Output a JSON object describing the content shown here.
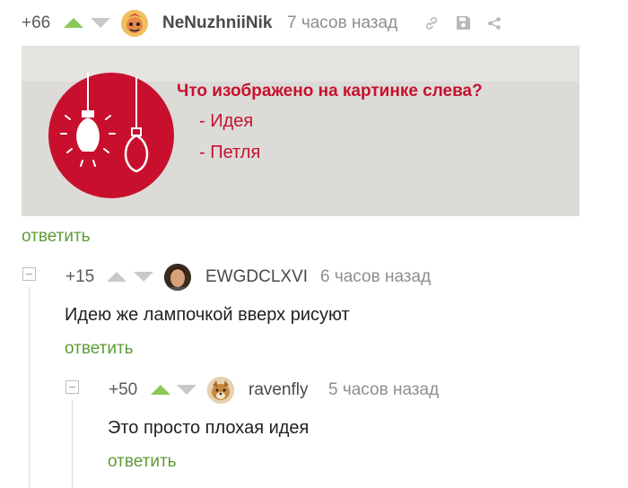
{
  "post": {
    "rating": "+66",
    "author": "NeNuzhniiNik",
    "time": "7 часов назад",
    "reply_label": "ответить",
    "picture": {
      "question": "Что изображено на картинке слева?",
      "options": [
        "- Идея",
        "- Петля"
      ]
    }
  },
  "comments": [
    {
      "rating": "+15",
      "author": "EWGDCLXVI",
      "time": "6 часов назад",
      "text": "Идею же лампочкой вверх рисуют",
      "reply_label": "ответить"
    },
    {
      "rating": "+50",
      "author": "ravenfly",
      "time": "5 часов назад",
      "text": "Это просто плохая идея",
      "reply_label": "ответить"
    }
  ],
  "colors": {
    "upvote_active": "#8ac858",
    "reply_link": "#5e9c36",
    "picture_red": "#c8102e"
  },
  "icons": [
    "link-icon",
    "save-icon",
    "share-icon",
    "collapse-icon"
  ]
}
